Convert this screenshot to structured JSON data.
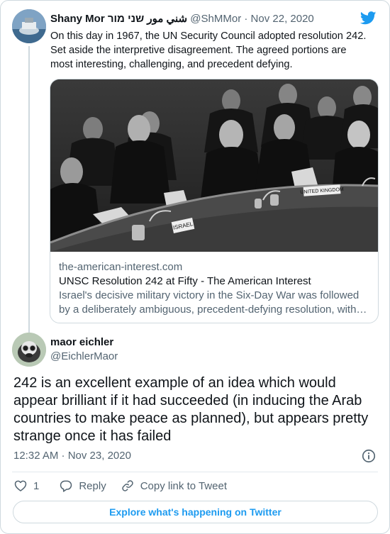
{
  "parent_tweet": {
    "author_name": "Shany Mor شني مور שני מור",
    "handle": "@ShMMor",
    "separator": "·",
    "date": "Nov 22, 2020",
    "text_lines": [
      "On this day in 1967, the UN Security Council adopted resolution 242.",
      "Set aside the interpretive disagreement. The agreed portions are",
      "most interesting, challenging, and precedent defying."
    ],
    "link_card": {
      "image_labels": [
        "UNITED KINGDOM",
        "ISRAEL"
      ],
      "domain": "the-american-interest.com",
      "title": "UNSC Resolution 242 at Fifty - The American Interest",
      "description_lines": [
        "Israel's decisive military victory in the Six-Day War was followed",
        "by a deliberately ambiguous, precedent-defying resolution, with…"
      ]
    }
  },
  "reply_tweet": {
    "author_name": "maor eichler",
    "handle": "@EichlerMaor",
    "text_lines": [
      "242 is an excellent example of an idea which would",
      "appear brilliant if it had succeeded (in inducing the Arab",
      "countries to make peace as planned), but appears pretty",
      "strange once it has failed"
    ],
    "timestamp": "12:32 AM · Nov 23, 2020"
  },
  "actions": {
    "like_count": "1",
    "reply_label": "Reply",
    "copy_link_label": "Copy link to Tweet"
  },
  "footer": {
    "explore_label": "Explore what's happening on Twitter"
  },
  "colors": {
    "twitter_blue": "#1d9bf0",
    "secondary_text": "#536471",
    "border": "#cfd9de"
  },
  "icons": [
    "twitter-bird-icon",
    "info-icon",
    "heart-icon",
    "reply-icon",
    "link-icon"
  ]
}
